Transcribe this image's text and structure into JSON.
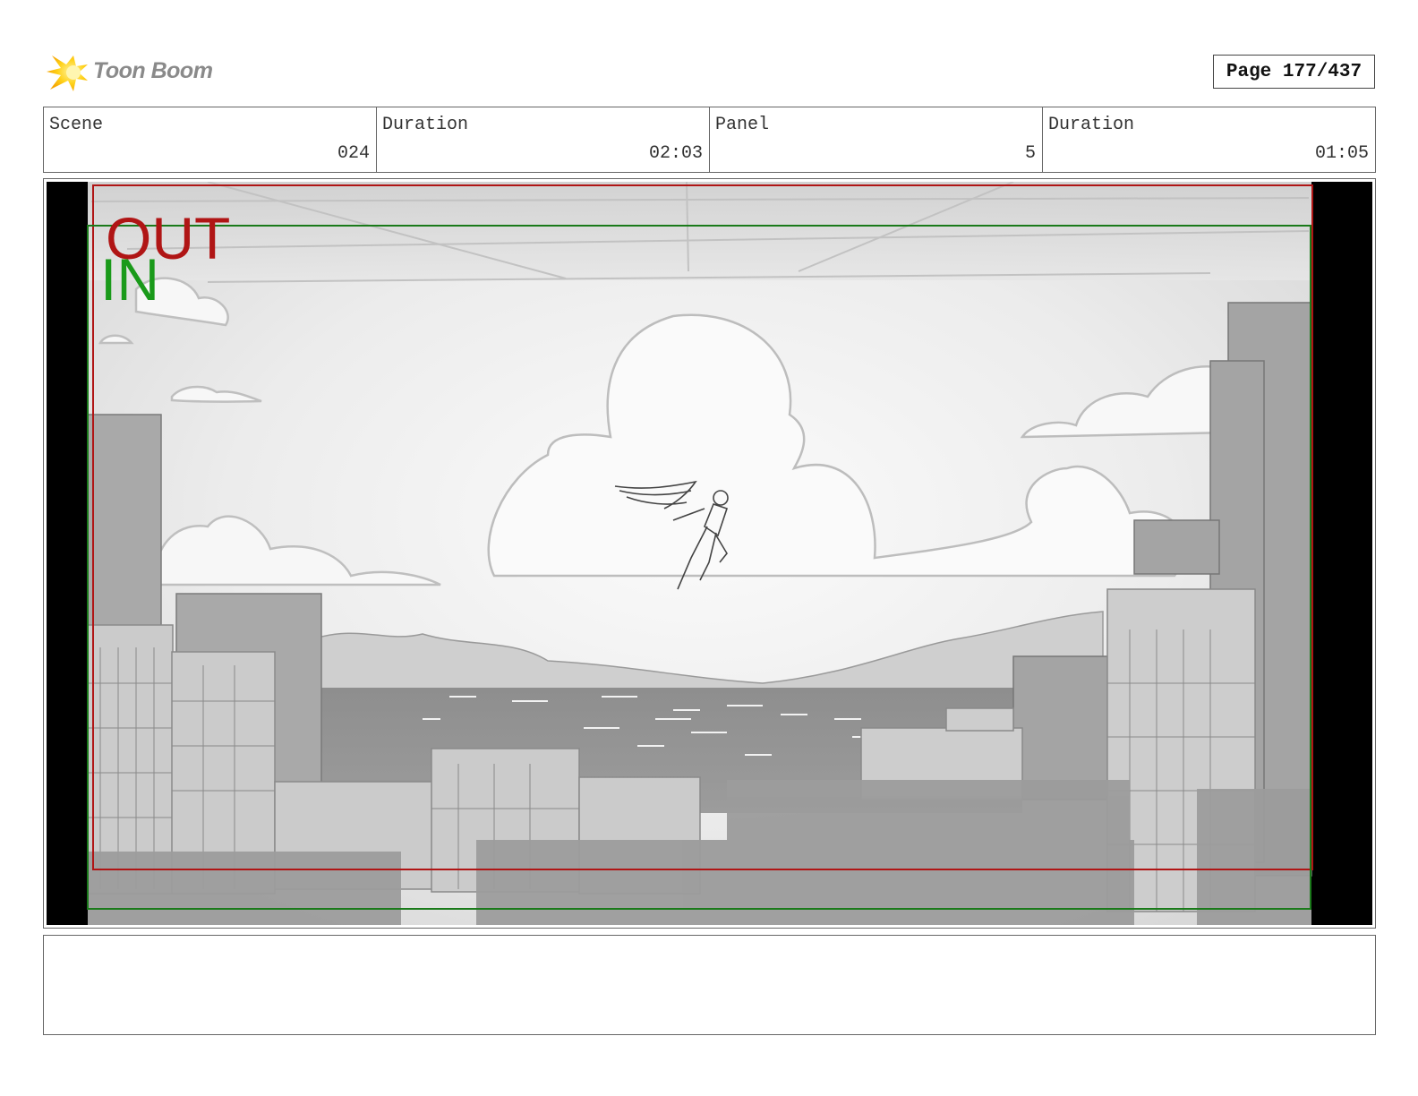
{
  "header": {
    "logo_text": "Toon Boom",
    "page_label": "Page 177/437"
  },
  "info": {
    "scene_label": "Scene",
    "scene_value": "024",
    "scene_duration_label": "Duration",
    "scene_duration_value": "02:03",
    "panel_label": "Panel",
    "panel_value": "5",
    "panel_duration_label": "Duration",
    "panel_duration_value": "01:05"
  },
  "panel": {
    "out_label": "OUT",
    "in_label": "IN",
    "out_color": "#b01515",
    "in_color": "#1a9a1a"
  },
  "notes": {
    "text": ""
  }
}
